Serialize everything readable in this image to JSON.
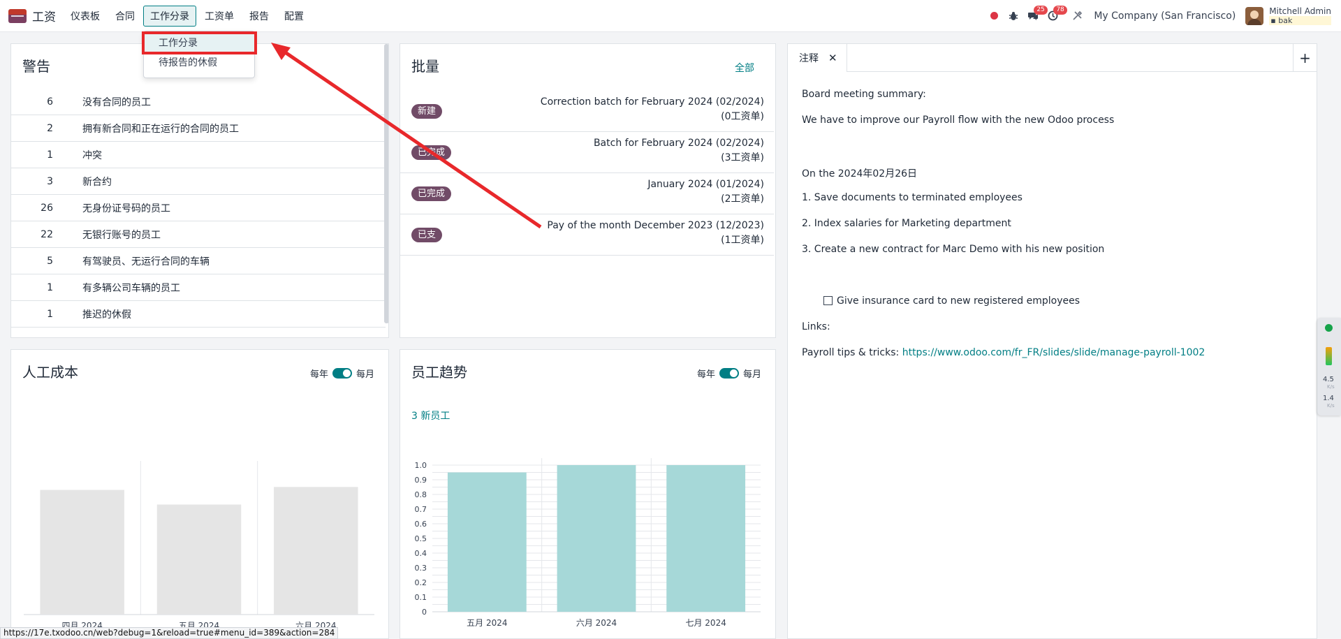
{
  "navbar": {
    "app_name": "工资",
    "menu": [
      "仪表板",
      "合同",
      "工作分录",
      "工资单",
      "报告",
      "配置"
    ],
    "active_menu": "工作分录",
    "messages_count": "25",
    "activities_count": "78",
    "company": "My Company (San Francisco)",
    "user_name": "Mitchell Admin",
    "user_db": "bak"
  },
  "dropdown": {
    "items": [
      "工作分录",
      "待报告的休假"
    ]
  },
  "warnings": {
    "title": "警告",
    "rows": [
      {
        "count": "6",
        "label": "没有合同的员工"
      },
      {
        "count": "2",
        "label": "拥有新合同和正在运行的合同的员工"
      },
      {
        "count": "1",
        "label": "冲突"
      },
      {
        "count": "3",
        "label": "新合约"
      },
      {
        "count": "26",
        "label": "无身份证号码的员工"
      },
      {
        "count": "22",
        "label": "无银行账号的员工"
      },
      {
        "count": "5",
        "label": "有驾驶员、无运行合同的车辆"
      },
      {
        "count": "1",
        "label": "有多辆公司车辆的员工"
      },
      {
        "count": "1",
        "label": "推迟的休假"
      }
    ]
  },
  "batches": {
    "title": "批量",
    "all_link": "全部",
    "rows": [
      {
        "status": "新建",
        "name": "Correction batch for February 2024 (02/2024)",
        "count": "(0工资单)"
      },
      {
        "status": "已完成",
        "name": "Batch for February 2024 (02/2024)",
        "count": "(3工资单)"
      },
      {
        "status": "已完成",
        "name": "January 2024 (01/2024)",
        "count": "(2工资单)"
      },
      {
        "status": "已支",
        "name": "Pay of the month December 2023 (12/2023)",
        "count": "(1工资单)"
      }
    ]
  },
  "labor_cost": {
    "title": "人工成本",
    "toggle_left": "每年",
    "toggle_right": "每月"
  },
  "employee_trend": {
    "title": "员工趋势",
    "toggle_left": "每年",
    "toggle_right": "每月",
    "kpi": "3 新员工"
  },
  "chart_data": [
    {
      "type": "bar",
      "categories": [
        "四月 2024",
        "五月 2024",
        "六月 2024"
      ],
      "values": [
        0.85,
        0.75,
        0.87
      ],
      "color": "#e5e5e5"
    },
    {
      "type": "bar",
      "categories": [
        "五月 2024",
        "六月 2024",
        "七月 2024"
      ],
      "values": [
        0.95,
        1.0,
        1.0
      ],
      "yticks": [
        "0",
        "0.1",
        "0.2",
        "0.3",
        "0.4",
        "0.5",
        "0.6",
        "0.7",
        "0.8",
        "0.9",
        "1.0"
      ],
      "ylim": [
        0,
        1.0
      ],
      "color": "#a6d8d8"
    }
  ],
  "notes": {
    "tab_label": "注释",
    "lines": [
      "Board meeting summary:",
      "We have to improve our Payroll flow with the new Odoo process",
      "On the 2024年02月26日",
      "1. Save documents to terminated employees",
      "2. Index salaries for Marketing department",
      "3. Create a new contract for Marc Demo with his new position",
      "Give insurance card to new registered employees",
      "Links:",
      "Payroll tips & tricks: "
    ],
    "link": "https://www.odoo.com/fr_FR/slides/slide/manage-payroll-1002"
  },
  "side_widget": {
    "up_value": "4.5",
    "up_unit": "K/s",
    "down_value": "1.4",
    "down_unit": "K/s"
  },
  "status_url": "https://17e.txodoo.cn/web?debug=1&reload=true#menu_id=389&action=284",
  "colors": {
    "accent": "#017e84",
    "brand": "#714b67",
    "annotation": "#e8282b"
  }
}
